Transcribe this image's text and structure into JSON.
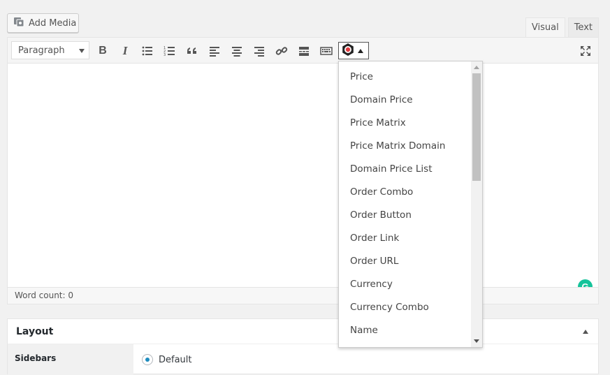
{
  "media": {
    "add_label": "Add Media"
  },
  "tabs": {
    "visual": "Visual",
    "text": "Text"
  },
  "toolbar": {
    "format_value": "Paragraph",
    "bold": "B",
    "italic": "I"
  },
  "status": {
    "word_count": "Word count: 0"
  },
  "grammarly": {
    "glyph": "G"
  },
  "dropdown": {
    "items": [
      "Price",
      "Domain Price",
      "Price Matrix",
      "Price Matrix Domain",
      "Domain Price List",
      "Order Combo",
      "Order Button",
      "Order Link",
      "Order URL",
      "Currency",
      "Currency Combo",
      "Name"
    ]
  },
  "layout": {
    "title": "Layout",
    "sidebars_label": "Sidebars",
    "sidebars_value": "Default"
  },
  "colors": {
    "accent": "#1e8cbe",
    "grammarly": "#15c39a",
    "plugin_red": "#e03a3e"
  }
}
